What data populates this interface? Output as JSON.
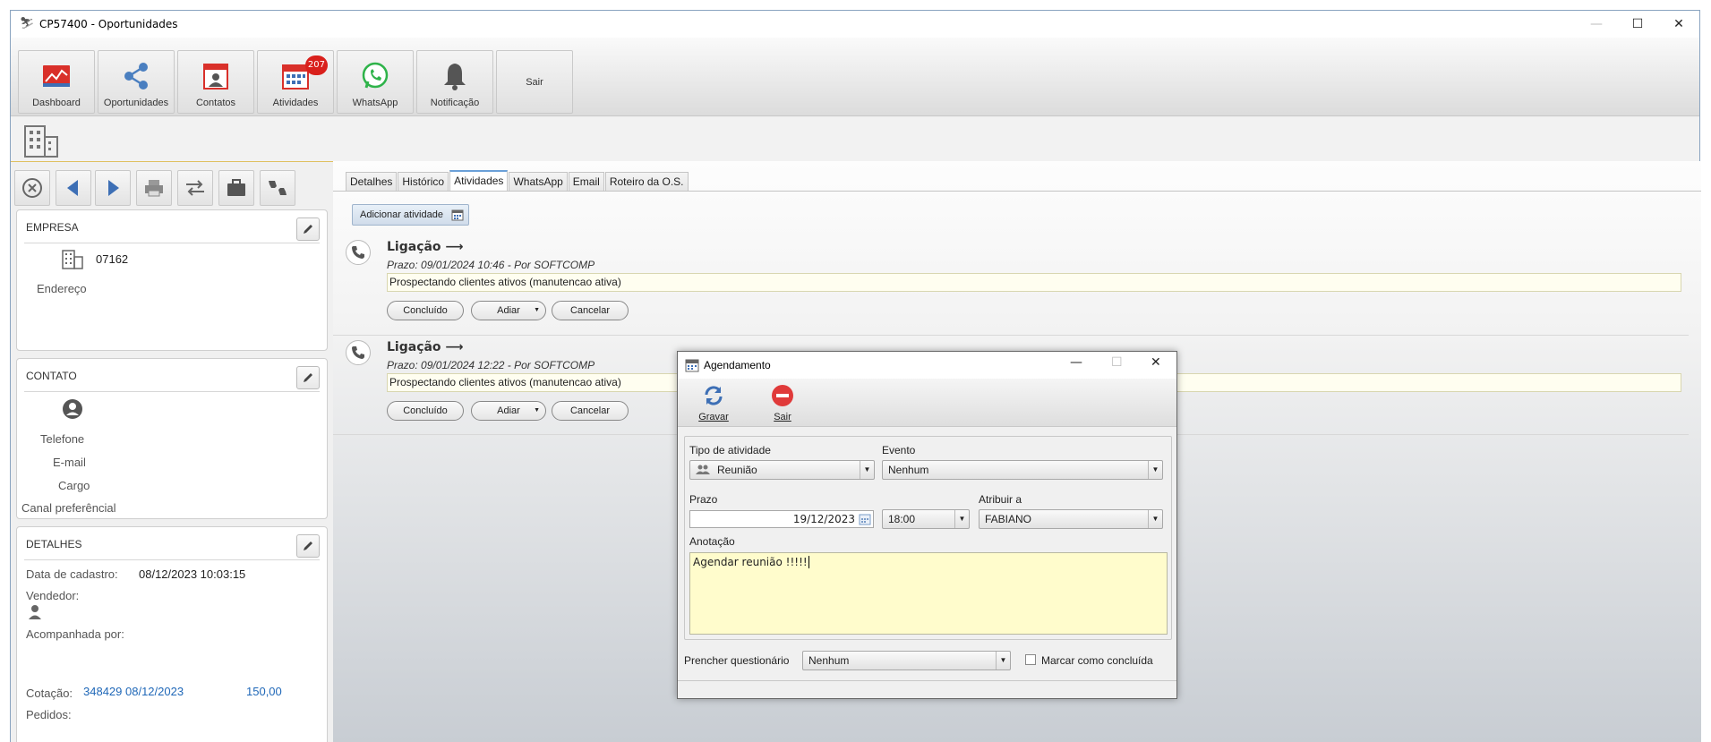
{
  "window": {
    "title": "CP57400 - Oportunidades",
    "minimize_glyph": "—",
    "maximize_glyph": "☐",
    "close_glyph": "✕"
  },
  "toolbar": {
    "buttons": [
      {
        "label": "Dashboard",
        "icon": "chart-icon"
      },
      {
        "label": "Oportunidades",
        "icon": "share-icon"
      },
      {
        "label": "Contatos",
        "icon": "contact-card-icon"
      },
      {
        "label": "Atividades",
        "icon": "calendar-icon",
        "badge": "207"
      },
      {
        "label": "WhatsApp",
        "icon": "whatsapp-icon"
      },
      {
        "label": "Notificação",
        "icon": "bell-icon"
      },
      {
        "label": "Sair",
        "icon": ""
      }
    ]
  },
  "company_panel": {
    "title": "EMPRESA",
    "code": "07162",
    "address_label": "Endereço"
  },
  "contact_panel": {
    "title": "CONTATO",
    "phone_label": "Telefone",
    "email_label": "E-mail",
    "role_label": "Cargo",
    "channel_label": "Canal preferêncial"
  },
  "details_panel": {
    "title": "DETALHES",
    "register_date_label": "Data de cadastro:",
    "register_date_value": "08/12/2023 10:03:15",
    "seller_label": "Vendedor:",
    "followed_label": "Acompanhada por:",
    "quote_label": "Cotação:",
    "quote_link": "348429 08/12/2023",
    "quote_value": "150,00",
    "orders_label": "Pedidos:"
  },
  "tabs": [
    "Detalhes",
    "Histórico",
    "Atividades",
    "WhatsApp",
    "Email",
    "Roteiro da O.S."
  ],
  "active_tab": "Atividades",
  "add_activity_label": "Adicionar atividade",
  "activities": [
    {
      "title": "Ligação ⟶",
      "subtitle": "Prazo: 09/01/2024 10:46 - Por SOFTCOMP",
      "note": "Prospectando clientes ativos (manutencao ativa)",
      "btn_done": "Concluído",
      "btn_postpone": "Adiar",
      "btn_cancel": "Cancelar"
    },
    {
      "title": "Ligação ⟶",
      "subtitle": "Prazo: 09/01/2024 12:22 - Por SOFTCOMP",
      "note": "Prospectando clientes ativos (manutencao ativa)",
      "btn_done": "Concluído",
      "btn_postpone": "Adiar",
      "btn_cancel": "Cancelar"
    }
  ],
  "dialog": {
    "title": "Agendamento",
    "save_label": "Gravar",
    "exit_label": "Sair",
    "activity_type_label": "Tipo de atividade",
    "activity_type_value": "Reunião",
    "event_label": "Evento",
    "event_value": "Nenhum",
    "deadline_label": "Prazo",
    "deadline_date": "19/12/2023",
    "deadline_time": "18:00",
    "assign_label": "Atribuir a",
    "assign_value": "FABIANO",
    "note_label": "Anotação",
    "note_value": "Agendar reunião !!!!!",
    "questionnaire_label": "Prencher questionário",
    "questionnaire_value": "Nenhum",
    "mark_done_label": "Marcar como concluída"
  },
  "colors": {
    "accent_red": "#d9201c",
    "link_blue": "#2068b8",
    "note_yellow": "#fffccc"
  }
}
